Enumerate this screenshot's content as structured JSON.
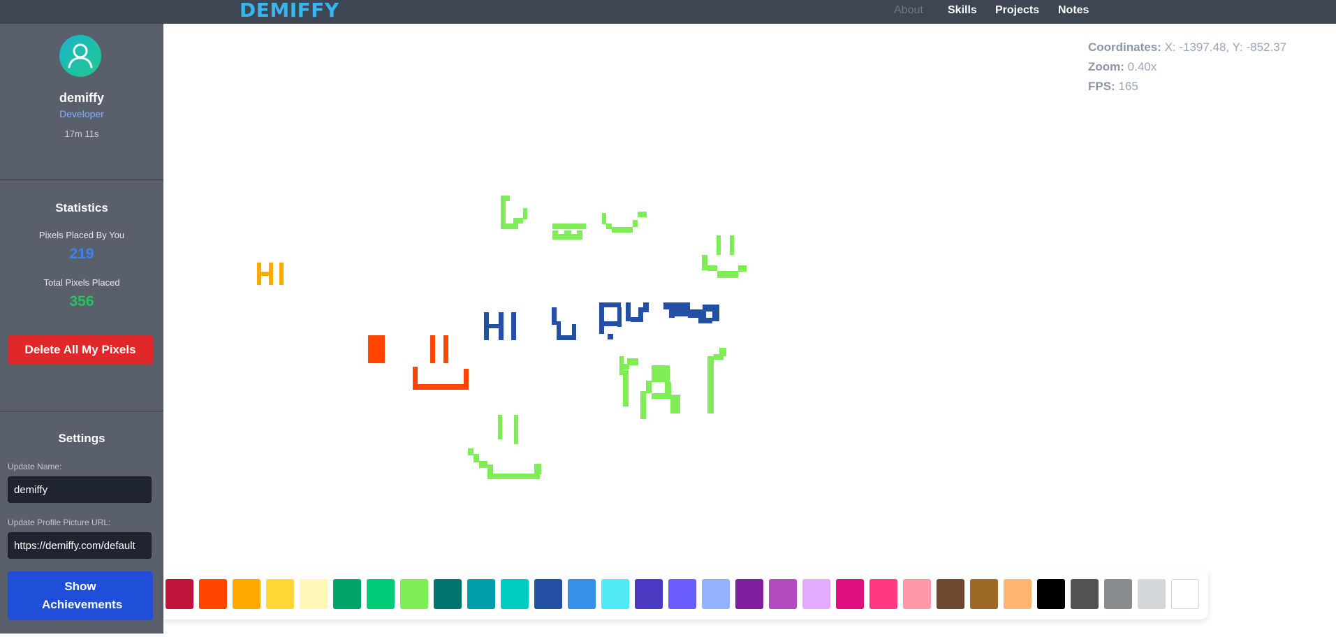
{
  "header": {
    "brand": "DEMIFFY",
    "nav": [
      "About",
      "Skills",
      "Projects",
      "Notes"
    ]
  },
  "sidebar": {
    "username": "demiffy",
    "role": "Developer",
    "session_time": "17m 11s",
    "statistics": {
      "title": "Statistics",
      "placed_by_you_label": "Pixels Placed By You",
      "placed_by_you_value": "219",
      "total_label": "Total Pixels Placed",
      "total_value": "356"
    },
    "delete_button": "Delete All My Pixels",
    "settings": {
      "title": "Settings",
      "name_label": "Update Name:",
      "name_value": "demiffy",
      "picture_label": "Update Profile Picture URL:",
      "picture_value": "https://demiffy.com/default"
    },
    "achievements_button": "Show Achievements"
  },
  "overlay": {
    "coordinates_label": "Coordinates:",
    "coordinates_value": "X: -1397.48, Y: -852.37",
    "zoom_label": "Zoom:",
    "zoom_value": "0.40x",
    "fps_label": "FPS:",
    "fps_value": "165"
  },
  "palette": [
    "#c0143c",
    "#ff4500",
    "#ffa800",
    "#ffd635",
    "#fff8b8",
    "#00a368",
    "#00cc78",
    "#7eed56",
    "#00756f",
    "#009eaa",
    "#00ccc0",
    "#2450a4",
    "#3690ea",
    "#51e9f4",
    "#493ac1",
    "#6a5cff",
    "#94b3ff",
    "#811e9f",
    "#b44ac0",
    "#e4abff",
    "#de107f",
    "#ff3881",
    "#ff99aa",
    "#6d482f",
    "#9c6926",
    "#ffb470",
    "#000000",
    "#515252",
    "#898d90",
    "#d4d7d9",
    "#ffffff"
  ],
  "colors": {
    "accent": "#38b6ef",
    "drawing_green": "#7eed56",
    "drawing_orange": "#ff4500",
    "drawing_yellow": "#ffa800",
    "drawing_blue": "#2450a4"
  }
}
